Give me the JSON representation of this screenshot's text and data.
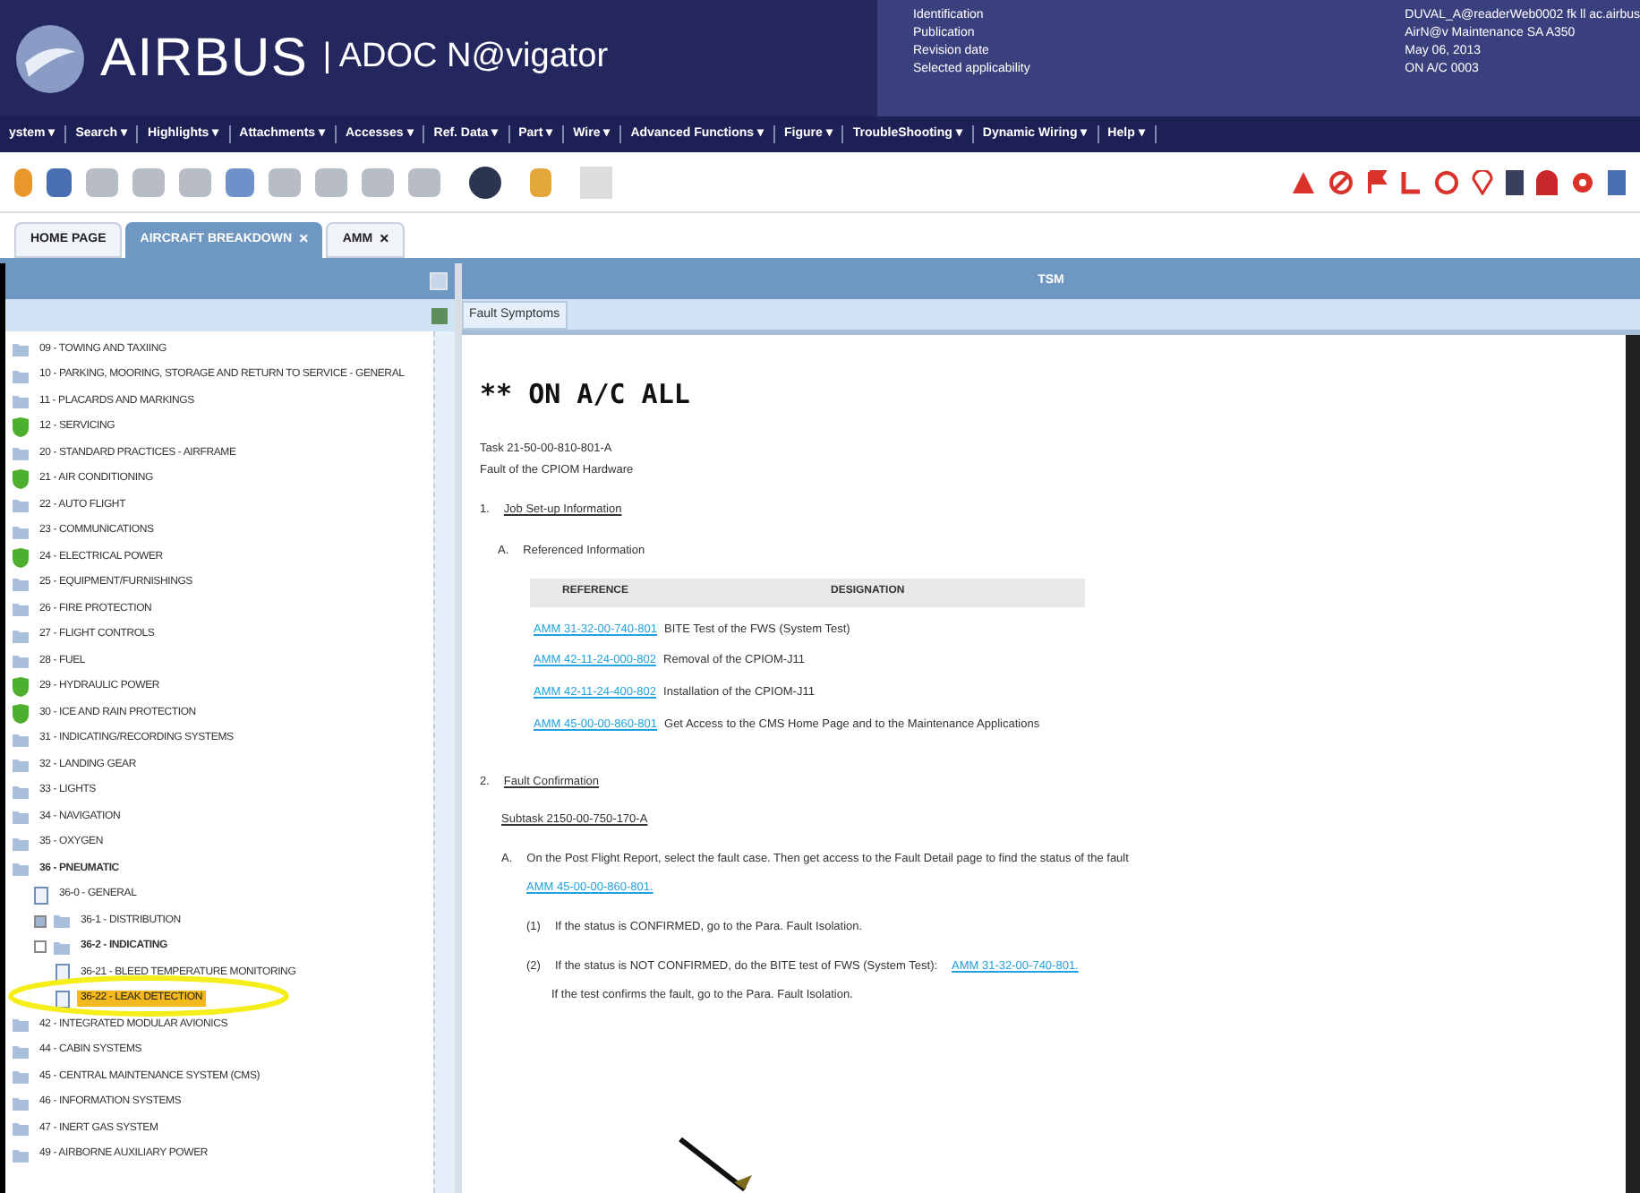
{
  "header": {
    "logo": "AIRBUS",
    "product": "| ADOC N@vigator",
    "info_labels": [
      "Identification",
      "Publication",
      "Revision date",
      "Selected applicability"
    ],
    "info_values": [
      "DUVAL_A@readerWeb0002 fk ll ac.airbus",
      "AirN@v Maintenance SA A350",
      "May 06, 2013",
      "ON A/C 0003"
    ]
  },
  "menu": [
    "ystem ▾",
    "Search ▾",
    "Highlights ▾",
    "Attachments ▾",
    "Accesses ▾",
    "Ref. Data ▾",
    "Part ▾",
    "Wire ▾",
    "Advanced Functions ▾",
    "Figure ▾",
    "TroubleShooting ▾",
    "Dynamic Wiring ▾",
    "Help ▾"
  ],
  "tabs": [
    {
      "label": "HOME PAGE",
      "selected": false,
      "closable": false
    },
    {
      "label": "AIRCRAFT BREAKDOWN",
      "selected": true,
      "closable": true
    },
    {
      "label": "AMM",
      "selected": false,
      "closable": true
    }
  ],
  "close_glyph": "×",
  "tree": [
    {
      "label": "09 - TOWING AND TAXIING",
      "green": false,
      "selected": false
    },
    {
      "label": "10 - PARKING, MOORING, STORAGE AND RETURN TO SERVICE - GENERAL",
      "green": false,
      "selected": false
    },
    {
      "label": "11 - PLACARDS AND MARKINGS",
      "green": false,
      "selected": false
    },
    {
      "label": "12 - SERVICING",
      "green": true,
      "selected": false
    },
    {
      "label": "20 - STANDARD PRACTICES - AIRFRAME",
      "green": false,
      "selected": false
    },
    {
      "label": "21 - AIR CONDITIONING",
      "green": true,
      "selected": false
    },
    {
      "label": "22 - AUTO FLIGHT",
      "green": false,
      "selected": false
    },
    {
      "label": "23 - COMMUNICATIONS",
      "green": false,
      "selected": false
    },
    {
      "label": "24 - ELECTRICAL POWER",
      "green": true,
      "selected": false
    },
    {
      "label": "25 - EQUIPMENT/FURNISHINGS",
      "green": false,
      "selected": false
    },
    {
      "label": "26 - FIRE PROTECTION",
      "green": false,
      "selected": false
    },
    {
      "label": "27 - FLIGHT CONTROLS",
      "green": false,
      "selected": false
    },
    {
      "label": "28 - FUEL",
      "green": false,
      "selected": false
    },
    {
      "label": "29 - HYDRAULIC POWER",
      "green": true,
      "selected": false
    },
    {
      "label": "30 - ICE AND RAIN PROTECTION",
      "green": true,
      "selected": false
    },
    {
      "label": "31 - INDICATING/RECORDING SYSTEMS",
      "green": false,
      "selected": false
    },
    {
      "label": "32 - LANDING GEAR",
      "green": false,
      "selected": false
    },
    {
      "label": "33 - LIGHTS",
      "green": false,
      "selected": false
    },
    {
      "label": "34 - NAVIGATION",
      "green": false,
      "selected": false
    },
    {
      "label": "35 - OXYGEN",
      "green": false,
      "selected": false
    },
    {
      "label": "36 - PNEUMATIC",
      "green": false,
      "selected": false,
      "expanded": true,
      "children": [
        {
          "label": "36-0 - GENERAL",
          "green": false,
          "selected": false,
          "leaf": true
        },
        {
          "label": "36-1 - DISTRIBUTION",
          "green": false,
          "selected": false,
          "expanded": false
        },
        {
          "label": "36-2 - INDICATING",
          "green": false,
          "selected": false,
          "expanded": true,
          "children": [
            {
              "label": "36-21 - BLEED TEMPERATURE MONITORING",
              "green": false,
              "leaf": true,
              "selected": false
            },
            {
              "label": "36-22 - LEAK DETECTION",
              "green": false,
              "leaf": true,
              "selected": true
            }
          ]
        }
      ]
    },
    {
      "label": "42 - INTEGRATED MODULAR AVIONICS",
      "green": false,
      "selected": false
    },
    {
      "label": "44 - CABIN SYSTEMS",
      "green": false,
      "selected": false
    },
    {
      "label": "45 - CENTRAL MAINTENANCE SYSTEM (CMS)",
      "green": false,
      "selected": false
    },
    {
      "label": "46 - INFORMATION SYSTEMS",
      "green": false,
      "selected": false
    },
    {
      "label": "47 - INERT GAS SYSTEM",
      "green": false,
      "selected": false
    },
    {
      "label": "49 - AIRBORNE AUXILIARY POWER",
      "green": false,
      "selected": false
    }
  ],
  "doc": {
    "panel_title": "TSM",
    "subtab": "Fault Symptoms",
    "heading": "** ON A/C ALL",
    "task": "Task 21-50-00-810-801-A",
    "task_title": "Fault of the CPIOM Hardware",
    "s1": "1.",
    "s1_title": "Job Set-up Information",
    "a": "A.",
    "a_title": "Referenced Information",
    "columns": [
      "REFERENCE",
      "DESIGNATION"
    ],
    "refs": [
      {
        "ref": "AMM 31-32-00-740-801",
        "designation": "BITE Test of the FWS (System Test)"
      },
      {
        "ref": "AMM 42-11-24-000-802",
        "designation": "Removal of the CPIOM-J11"
      },
      {
        "ref": "AMM 42-11-24-400-802",
        "designation": "Installation of the CPIOM-J11"
      },
      {
        "ref": "AMM 45-00-00-860-801",
        "designation": "Get Access to the CMS Home Page and to the Maintenance Applications"
      }
    ],
    "s2": "2.",
    "s2_title": "Fault Confirmation",
    "subtask": "Subtask 2150-00-750-170-A",
    "step_a": "A.",
    "step_a_text": "On the Post Flight Report, select the fault case. Then get access to the Fault Detail page to find the status of the fault",
    "step_a_link": "AMM 45-00-00-860-801.",
    "p1": "(1)",
    "p1_text": "If the status is CONFIRMED, go to the Para. Fault Isolation.",
    "p2": "(2)",
    "p2_text": "If the status is NOT CONFIRMED, do the BITE test of FWS (System Test):",
    "p2_link": "AMM 31-32-00-740-801.",
    "p2_more": "If the test confirms the fault, go to the Para. Fault Isolation."
  }
}
